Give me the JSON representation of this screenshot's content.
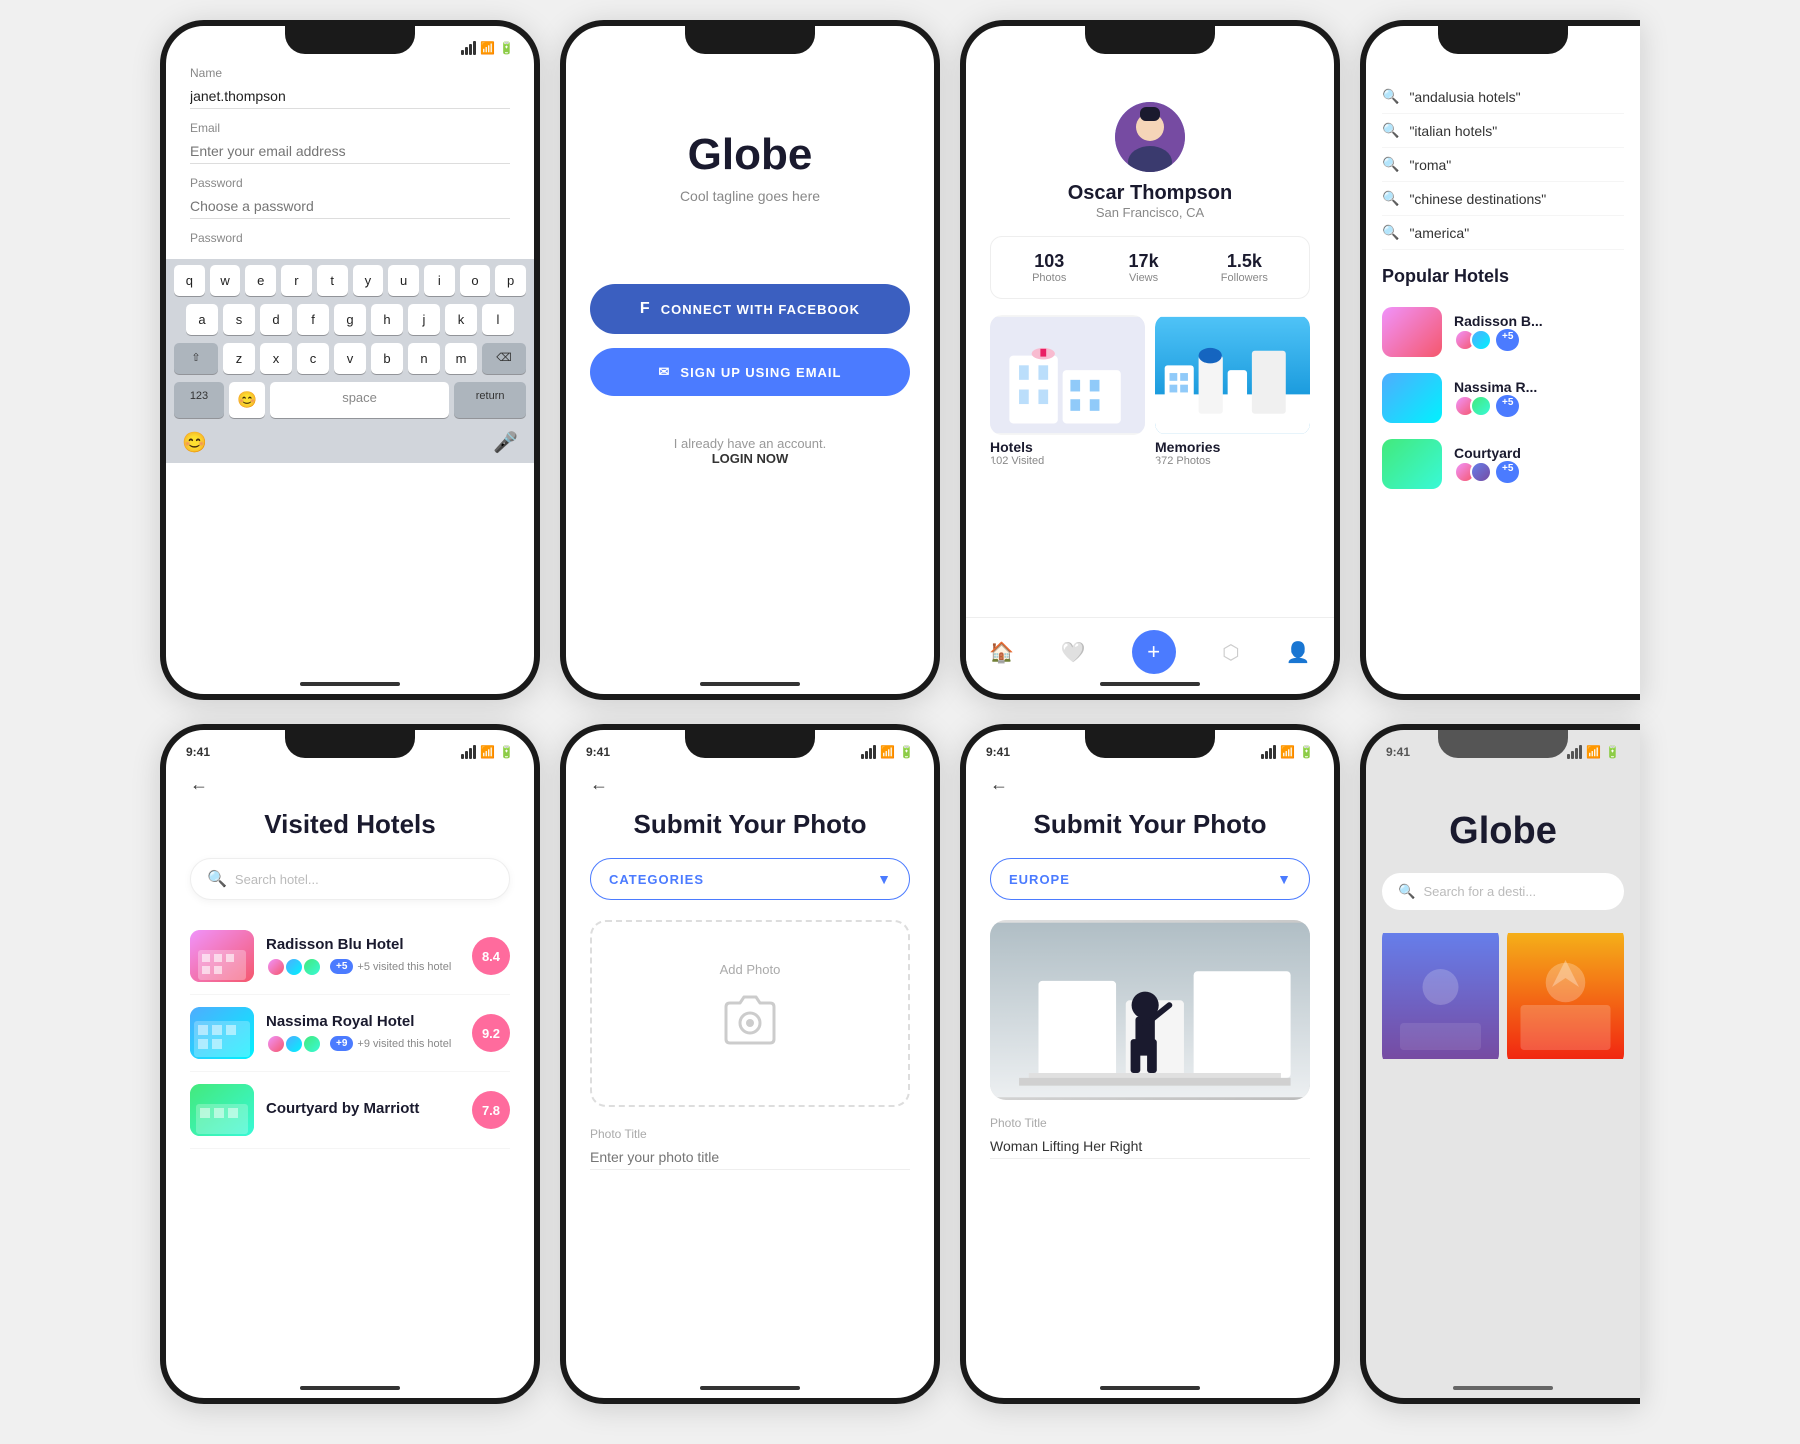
{
  "phones": {
    "row1": [
      {
        "id": "keyboard-phone",
        "statusBar": {
          "time": "",
          "icons": true
        },
        "form": {
          "nameLabel": "Name",
          "nameValue": "janet.thompson",
          "emailLabel": "Email",
          "emailPlaceholder": "Enter your email address",
          "passwordLabel": "Password",
          "passwordPlaceholder": "Choose a password",
          "password2Label": "Password"
        },
        "keyboard": {
          "rows": [
            [
              "q",
              "w",
              "e",
              "r",
              "t",
              "y",
              "u",
              "i",
              "o",
              "p"
            ],
            [
              "a",
              "s",
              "d",
              "f",
              "g",
              "h",
              "j",
              "k",
              "l"
            ],
            [
              "z",
              "x",
              "c",
              "v",
              "b",
              "n",
              "m"
            ]
          ],
          "specials": [
            "123",
            "space",
            "return"
          ],
          "bottom": [
            "😊",
            "🎤"
          ]
        }
      },
      {
        "id": "globe-signup-phone",
        "statusBar": {
          "time": "",
          "icons": false
        },
        "globe": {
          "title": "Globe",
          "tagline": "Cool tagline goes here",
          "facebookBtn": "CONNECT WITH FACEBOOK",
          "emailBtn": "SIGN UP USING EMAIL",
          "alreadyText": "I already have an account.",
          "loginLink": "LOGIN NOW"
        }
      },
      {
        "id": "profile-phone",
        "statusBar": {
          "time": "",
          "icons": false
        },
        "profile": {
          "name": "Oscar Thompson",
          "location": "San Francisco, CA",
          "stats": [
            {
              "num": "103",
              "label": "Photos"
            },
            {
              "num": "17k",
              "label": "Views"
            },
            {
              "num": "1.5k",
              "label": "Followers"
            }
          ],
          "cards": [
            {
              "label": "Hotels",
              "sub": "102 Visited"
            },
            {
              "label": "Memories",
              "sub": "372 Photos"
            }
          ]
        }
      },
      {
        "id": "search-partial-phone",
        "statusBar": {
          "time": "",
          "icons": false
        },
        "search": {
          "items": [
            "\"andalusia hotels\"",
            "\"italian hotels\"",
            "\"roma\"",
            "\"chinese destinations\"",
            "\"america\""
          ],
          "popularTitle": "Popular Hotels",
          "hotels": [
            {
              "name": "Radisson B...",
              "badge": "+5"
            },
            {
              "name": "Nassima R...",
              "badge": "+5"
            },
            {
              "name": "Courtyard",
              "badge": "+5"
            }
          ]
        }
      }
    ],
    "row2": [
      {
        "id": "visited-hotels-phone",
        "statusBar": {
          "time": "9:41",
          "icons": true
        },
        "visited": {
          "title": "Visited Hotels",
          "searchPlaceholder": "Search hotel...",
          "hotels": [
            {
              "name": "Radisson Blu Hotel",
              "score": "8.4",
              "visitors": "+5 visited this hotel",
              "scoreColor": "pink"
            },
            {
              "name": "Nassima Royal Hotel",
              "score": "9.2",
              "visitors": "+9 visited this hotel",
              "scoreColor": "pink"
            },
            {
              "name": "Courtyard by Marriott",
              "score": "7.8",
              "visitors": "",
              "scoreColor": "pink"
            }
          ]
        }
      },
      {
        "id": "submit-photo-categories-phone",
        "statusBar": {
          "time": "9:41",
          "icons": true
        },
        "submitPhoto": {
          "title": "Submit Your Photo",
          "dropdown": "CATEGORIES",
          "addPhotoLabel": "Add Photo",
          "photoTitleLabel": "Photo Title",
          "photoTitlePlaceholder": "Enter your photo title"
        }
      },
      {
        "id": "submit-photo-europe-phone",
        "statusBar": {
          "time": "9:41",
          "icons": true
        },
        "submitEurope": {
          "title": "Submit Your Photo",
          "dropdown": "EUROPE",
          "photoTitleLabel": "Photo Title",
          "photoTitleValue": "Woman Lifting Her Right"
        }
      },
      {
        "id": "globe-partial-phone",
        "statusBar": {
          "time": "9:41",
          "icons": true
        },
        "globePartial": {
          "title": "Globe",
          "searchPlaceholder": "Search for a desti..."
        }
      }
    ]
  }
}
